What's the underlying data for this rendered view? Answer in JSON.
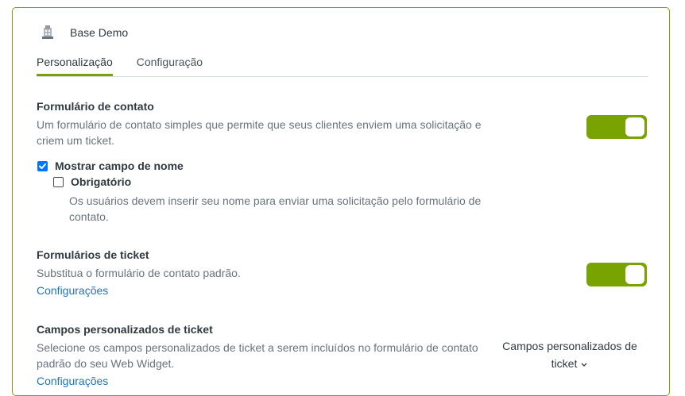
{
  "header": {
    "brand_name": "Base Demo",
    "icon": "building-icon"
  },
  "tabs": [
    {
      "label": "Personalização",
      "active": true
    },
    {
      "label": "Configuração",
      "active": false
    }
  ],
  "contact_form": {
    "title": "Formulário de contato",
    "description": "Um formulário de contato simples que permite que seus clientes enviem uma solicitação e criem um ticket.",
    "toggle_on": true,
    "show_name": {
      "label": "Mostrar campo de nome",
      "checked": true
    },
    "required": {
      "label": "Obrigatório",
      "checked": false,
      "hint": "Os usuários devem inserir seu nome para enviar uma solicitação pelo formulário de contato."
    }
  },
  "ticket_forms": {
    "title": "Formulários de ticket",
    "description": "Substitua o formulário de contato padrão.",
    "link": "Configurações",
    "toggle_on": true
  },
  "custom_fields": {
    "title": "Campos personalizados de ticket",
    "description": "Selecione os campos personalizados de ticket a serem incluídos no formulário de contato padrão do seu Web Widget.",
    "link": "Configurações",
    "dropdown_line1": "Campos personalizados de",
    "dropdown_line2": "ticket"
  },
  "colors": {
    "accent": "#78a300",
    "link": "#1f73b7",
    "checkbox": "#0075ff"
  }
}
